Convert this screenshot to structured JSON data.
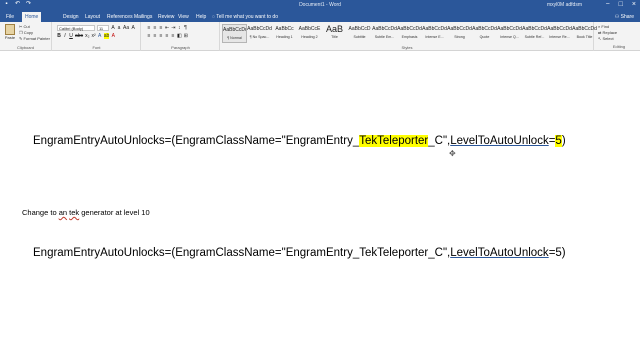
{
  "titlebar": {
    "title": "Document1 - Word",
    "user": "mxyl0M adfdsm",
    "qa_icons": [
      "save-icon",
      "undo-icon",
      "redo-icon"
    ],
    "win_buttons": [
      "−",
      "□",
      "×"
    ]
  },
  "menu": {
    "tabs": [
      "File",
      "Home",
      "Design",
      "Layout",
      "References",
      "Mailings",
      "Review",
      "View",
      "Help"
    ],
    "active": "Home",
    "tell_me": "Tell me what you want to do",
    "share": "Share"
  },
  "ribbon": {
    "clipboard": {
      "paste": "Paste",
      "cut": "Cut",
      "copy": "Copy",
      "format_painter": "Format Painter",
      "label": "Clipboard"
    },
    "font": {
      "family": "Calibri (Body)",
      "size": "11",
      "label": "Font",
      "row1": [
        "B",
        "I",
        "U",
        "abc",
        "x₂",
        "x²"
      ],
      "row2": [
        "A",
        "ab",
        "A"
      ]
    },
    "paragraph": {
      "label": "Paragraph",
      "row1": [
        "≡",
        "≡",
        "≡",
        "⇤",
        "⇥",
        "↕",
        "¶"
      ],
      "row2": [
        "≡",
        "≡",
        "≡",
        "≡",
        "≡",
        "◧",
        "⊞"
      ]
    },
    "styles": {
      "label": "Styles",
      "items": [
        {
          "preview": "AaBbCcDd",
          "name": "¶ Normal"
        },
        {
          "preview": "AaBbCcDd",
          "name": "¶ No Spac..."
        },
        {
          "preview": "AaBbCc",
          "name": "Heading 1"
        },
        {
          "preview": "AaBbCcE",
          "name": "Heading 2"
        },
        {
          "preview": "AaB",
          "name": "Title"
        },
        {
          "preview": "AaBbCcD",
          "name": "Subtitle"
        },
        {
          "preview": "AaBbCcDd",
          "name": "Subtle Em..."
        },
        {
          "preview": "AaBbCcDd",
          "name": "Emphasis"
        },
        {
          "preview": "AaBbCcDd",
          "name": "Intense E..."
        },
        {
          "preview": "AaBbCcDd",
          "name": "Strong"
        },
        {
          "preview": "AaBbCcDd",
          "name": "Quote"
        },
        {
          "preview": "AaBbCcDd",
          "name": "Intense Q..."
        },
        {
          "preview": "AaBbCcDd",
          "name": "Subtle Ref..."
        },
        {
          "preview": "AaBbCcDd",
          "name": "Intense Re..."
        },
        {
          "preview": "AaBbCcDd",
          "name": "Book Title"
        }
      ]
    },
    "editing": {
      "find": "Find",
      "replace": "Replace",
      "select": "Select",
      "label": "Editing"
    }
  },
  "document": {
    "line1": {
      "before": "EngramEntryAutoUnlocks=(EngramClassName=\"EngramEntry_",
      "highlight": "TekTeleporter",
      "middle": "_C\",",
      "level_word": "LevelToAutoUnlock",
      "eq": "=",
      "value": "5",
      "close": ")"
    },
    "note": {
      "pre": "Change to ",
      "sq1": "an",
      "mid": " ",
      "sq2": "tek",
      "post": " generator at level 10"
    },
    "line2": {
      "before": "EngramEntryAutoUnlocks=(EngramClassName=\"EngramEntry_TekTeleporter_C\",",
      "level_word": "LevelToAutoUnlock",
      "after": "=5)"
    }
  },
  "colors": {
    "accent": "#2b579a",
    "highlight": "#ffff00"
  }
}
